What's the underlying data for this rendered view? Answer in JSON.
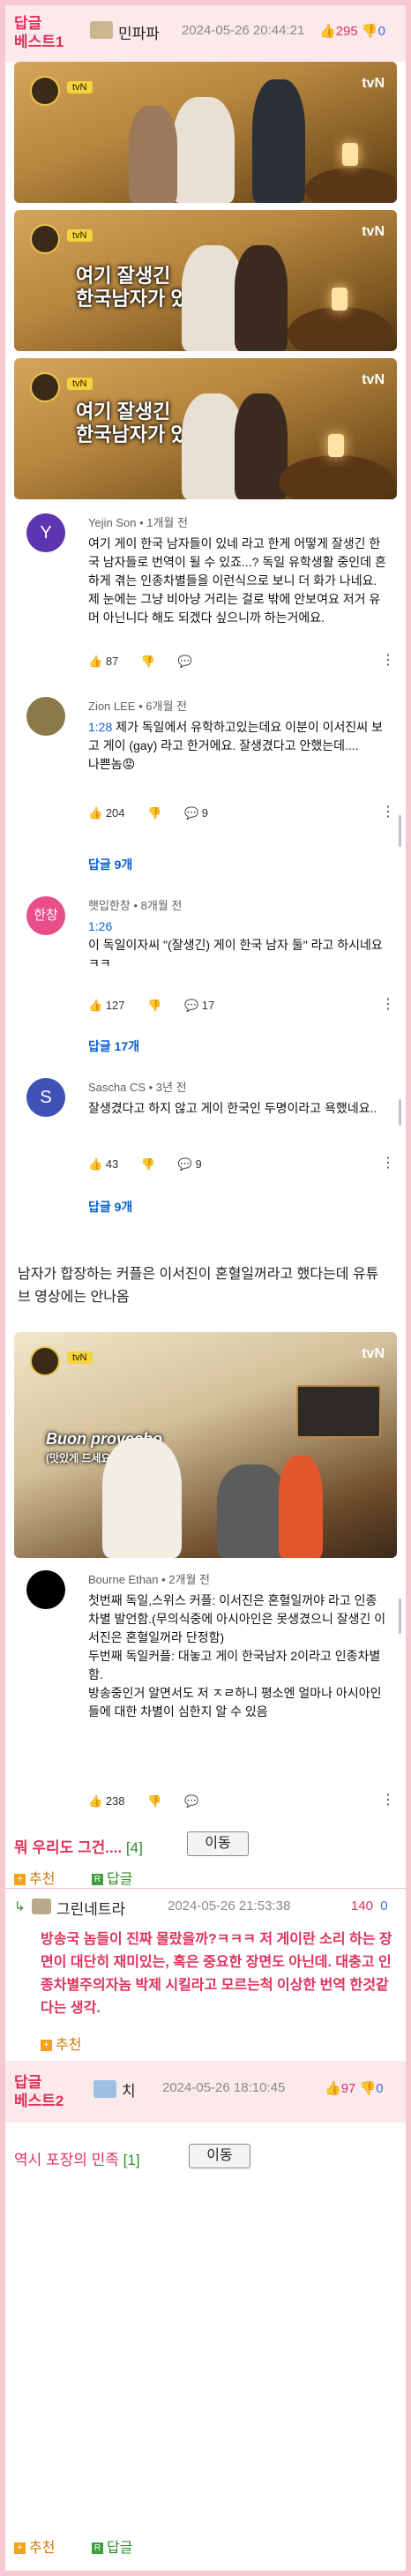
{
  "best1": {
    "label_line1": "답글",
    "label_line2": "베스트1",
    "nickname": "민파파",
    "datetime": "2024-05-26 20:44:21",
    "up": "295",
    "down": "0"
  },
  "video": {
    "channel": "tvN",
    "badge": "tvN",
    "caption_line1": "여기 잘생긴",
    "caption_line2": "한국남자가 있네",
    "caption4_line1": "Buon provecho",
    "caption4_line2": "(맛있게 드세요)"
  },
  "comments": [
    {
      "avatar": "Y",
      "avatar_color": "#5e35b1",
      "meta": "Yejin Son • 1개월 전",
      "text": "여기 게이 한국 남자들이 있네 라고 한게 어떻게 잘생긴 한국 남자들로 번역이 될 수 있죠...? 독일 유학생활 중인데 흔하게 겪는 인종차별들을 이런식으로 보니 더 화가 나네요. 제 눈에는 그냥 비아냥 거리는 걸로 밖에 안보여요 저거 유머 아닌니다 해도 되겠다 싶으니까 하는거에요.",
      "likes": "87",
      "replies_count": "",
      "replies_label": ""
    },
    {
      "avatar": "",
      "avatar_color": "#8a7a4a",
      "meta": "Zion LEE • 6개월 전",
      "timestamp": "1:28",
      "text": " 제가 독일에서 유학하고있는데요 이분이 이서진씨 보고 게이 (gay) 라고 한거에요. 잘생겼다고 안했는데....",
      "text2": "나쁜놈😡",
      "likes": "204",
      "replies_count": "9",
      "replies_label": "답글 9개"
    },
    {
      "avatar": "한창",
      "avatar_color": "#e84e8a",
      "meta": "햇입한창 • 8개월 전",
      "timestamp": "1:26",
      "text": "이 독일이자씨 \"(잘생긴) 게이 한국 남자 둘\" 라고 하시네요 ㅋㅋ",
      "likes": "127",
      "replies_count": "17",
      "replies_label": "답글 17개"
    },
    {
      "avatar": "S",
      "avatar_color": "#3f51b5",
      "meta": "Sascha CS • 3년 전",
      "text": "잘생겼다고 하지 않고 게이 한국인 두명이라고 욕했네요..",
      "likes": "43",
      "replies_count": "9",
      "replies_label": "답글 9개"
    },
    {
      "avatar": "",
      "avatar_color": "#000000",
      "meta": "Bourne Ethan • 2개월 전",
      "text": "첫번째 독일,스위스 커플: 이서진은 혼혈일꺼야 라고 인종차별 발언함.(무의식중에 아시아인은 못생겼으니 잘생긴 이서진은 혼혈일꺼라 단정함)\n두번째 독일커플: 대놓고 게이 한국남자 2이라고 인종차별함.\n방송중인거 알면서도 저 ㅈㄹ하니 평소엔 얼마나 아시아인들에 대한 차별이 심한지 알 수 있음",
      "likes": "238",
      "replies_count": "",
      "replies_label": ""
    }
  ],
  "post_text": "남자가 합장하는 커플은 이서진이 혼혈일꺼라고 했다는데 유튜브 영상에는 안나옴",
  "reply_title": "뭐 우리도 그건....",
  "reply_count": "[4]",
  "move_label": "이동",
  "recommend_label": "추천",
  "reply_label": "답글",
  "subreply": {
    "nickname": "그린네트라",
    "datetime": "2024-05-26 21:53:38",
    "score": "140",
    "down": "0",
    "text": "방송국 놈들이 진짜 몰랐을까?ㅋㅋㅋ 저 게이란 소리 하는 장면이 대단히 재미있는, 혹은 중요한 장면도 아닌데. 대충고 인종차별주의자놈 박제 시킬라고 모르는척 이상한 번역 한것같다는 생각."
  },
  "best2": {
    "label_line1": "답글",
    "label_line2": "베스트2",
    "nickname": "치",
    "datetime": "2024-05-26 18:10:45",
    "up": "97",
    "down": "0",
    "text": "역시 포장의 민족",
    "count": "[1]"
  },
  "colors": {
    "accent": "#e0315b",
    "link": "#065fd4",
    "frame": "#f6c9d1"
  }
}
